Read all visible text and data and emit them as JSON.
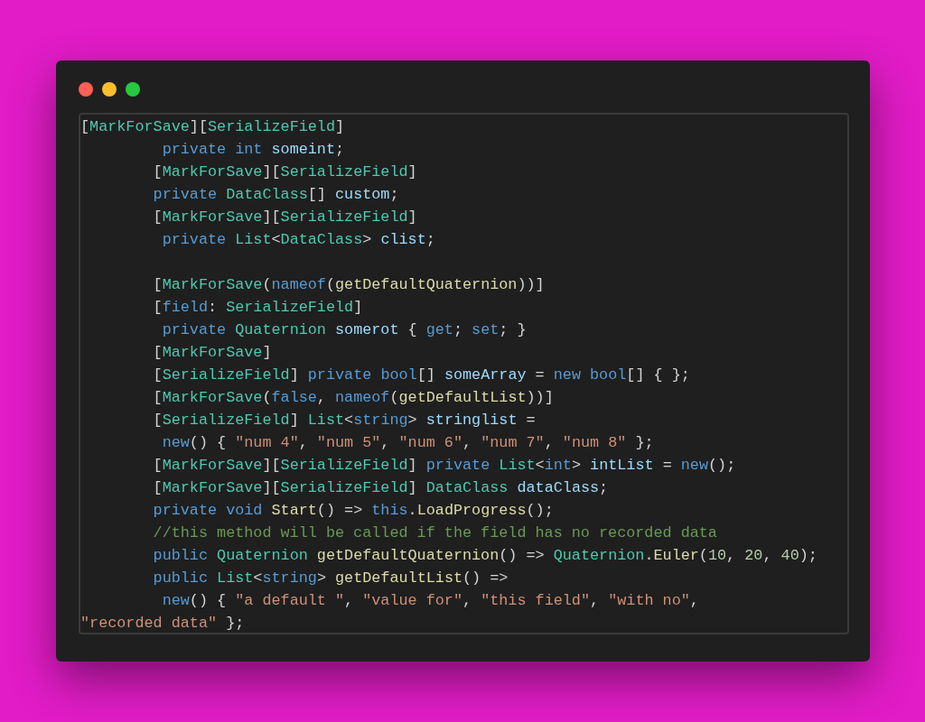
{
  "window": {
    "controls": [
      {
        "kind": "close"
      },
      {
        "kind": "minimize"
      },
      {
        "kind": "zoom"
      }
    ]
  },
  "code": [
    {
      "kind": "flat",
      "tokens": [
        {
          "kind": "plain",
          "text": "["
        },
        {
          "kind": "attr",
          "text": "MarkForSave"
        },
        {
          "kind": "plain",
          "text": "]["
        },
        {
          "kind": "attr",
          "text": "SerializeField"
        },
        {
          "kind": "plain",
          "text": "]"
        }
      ]
    },
    {
      "kind": "deep",
      "tokens": [
        {
          "kind": "keyword",
          "text": "private "
        },
        {
          "kind": "keyword",
          "text": "int "
        },
        {
          "kind": "var",
          "text": "someint"
        },
        {
          "kind": "plain",
          "text": ";"
        }
      ]
    },
    {
      "kind": "indented",
      "tokens": [
        {
          "kind": "plain",
          "text": "["
        },
        {
          "kind": "attr",
          "text": "MarkForSave"
        },
        {
          "kind": "plain",
          "text": "]["
        },
        {
          "kind": "attr",
          "text": "SerializeField"
        },
        {
          "kind": "plain",
          "text": "]"
        }
      ]
    },
    {
      "kind": "indented",
      "tokens": [
        {
          "kind": "keyword",
          "text": "private "
        },
        {
          "kind": "type",
          "text": "DataClass"
        },
        {
          "kind": "plain",
          "text": "[] "
        },
        {
          "kind": "var",
          "text": "custom"
        },
        {
          "kind": "plain",
          "text": ";"
        }
      ]
    },
    {
      "kind": "indented",
      "tokens": [
        {
          "kind": "plain",
          "text": "["
        },
        {
          "kind": "attr",
          "text": "MarkForSave"
        },
        {
          "kind": "plain",
          "text": "]["
        },
        {
          "kind": "attr",
          "text": "SerializeField"
        },
        {
          "kind": "plain",
          "text": "]"
        }
      ]
    },
    {
      "kind": "deep",
      "tokens": [
        {
          "kind": "keyword",
          "text": "private "
        },
        {
          "kind": "type",
          "text": "List"
        },
        {
          "kind": "plain",
          "text": "<"
        },
        {
          "kind": "type",
          "text": "DataClass"
        },
        {
          "kind": "plain",
          "text": "> "
        },
        {
          "kind": "var",
          "text": "clist"
        },
        {
          "kind": "plain",
          "text": ";"
        }
      ]
    },
    {
      "kind": "blank"
    },
    {
      "kind": "indented",
      "tokens": [
        {
          "kind": "plain",
          "text": "["
        },
        {
          "kind": "attr",
          "text": "MarkForSave"
        },
        {
          "kind": "plain",
          "text": "("
        },
        {
          "kind": "keyword",
          "text": "nameof"
        },
        {
          "kind": "plain",
          "text": "("
        },
        {
          "kind": "method",
          "text": "getDefaultQuaternion"
        },
        {
          "kind": "plain",
          "text": "))]"
        }
      ]
    },
    {
      "kind": "indented",
      "tokens": [
        {
          "kind": "plain",
          "text": "["
        },
        {
          "kind": "keyword",
          "text": "field"
        },
        {
          "kind": "plain",
          "text": ": "
        },
        {
          "kind": "attr",
          "text": "SerializeField"
        },
        {
          "kind": "plain",
          "text": "]"
        }
      ]
    },
    {
      "kind": "deep",
      "tokens": [
        {
          "kind": "keyword",
          "text": "private "
        },
        {
          "kind": "type",
          "text": "Quaternion "
        },
        {
          "kind": "var",
          "text": "somerot"
        },
        {
          "kind": "plain",
          "text": " { "
        },
        {
          "kind": "keyword",
          "text": "get"
        },
        {
          "kind": "plain",
          "text": "; "
        },
        {
          "kind": "keyword",
          "text": "set"
        },
        {
          "kind": "plain",
          "text": "; }"
        }
      ]
    },
    {
      "kind": "indented",
      "tokens": [
        {
          "kind": "plain",
          "text": "["
        },
        {
          "kind": "attr",
          "text": "MarkForSave"
        },
        {
          "kind": "plain",
          "text": "]"
        }
      ]
    },
    {
      "kind": "indented",
      "tokens": [
        {
          "kind": "plain",
          "text": "["
        },
        {
          "kind": "attr",
          "text": "SerializeField"
        },
        {
          "kind": "plain",
          "text": "] "
        },
        {
          "kind": "keyword",
          "text": "private "
        },
        {
          "kind": "keyword",
          "text": "bool"
        },
        {
          "kind": "plain",
          "text": "[] "
        },
        {
          "kind": "var",
          "text": "someArray"
        },
        {
          "kind": "plain",
          "text": " = "
        },
        {
          "kind": "keyword",
          "text": "new "
        },
        {
          "kind": "keyword",
          "text": "bool"
        },
        {
          "kind": "plain",
          "text": "[] { };"
        }
      ]
    },
    {
      "kind": "indented",
      "tokens": [
        {
          "kind": "plain",
          "text": "["
        },
        {
          "kind": "attr",
          "text": "MarkForSave"
        },
        {
          "kind": "plain",
          "text": "("
        },
        {
          "kind": "keyword",
          "text": "false"
        },
        {
          "kind": "plain",
          "text": ", "
        },
        {
          "kind": "keyword",
          "text": "nameof"
        },
        {
          "kind": "plain",
          "text": "("
        },
        {
          "kind": "method",
          "text": "getDefaultList"
        },
        {
          "kind": "plain",
          "text": "))]"
        }
      ]
    },
    {
      "kind": "indented",
      "tokens": [
        {
          "kind": "plain",
          "text": "["
        },
        {
          "kind": "attr",
          "text": "SerializeField"
        },
        {
          "kind": "plain",
          "text": "] "
        },
        {
          "kind": "type",
          "text": "List"
        },
        {
          "kind": "plain",
          "text": "<"
        },
        {
          "kind": "keyword",
          "text": "string"
        },
        {
          "kind": "plain",
          "text": "> "
        },
        {
          "kind": "var",
          "text": "stringlist"
        },
        {
          "kind": "plain",
          "text": " ="
        }
      ]
    },
    {
      "kind": "deep",
      "tokens": [
        {
          "kind": "keyword",
          "text": "new"
        },
        {
          "kind": "plain",
          "text": "() { "
        },
        {
          "kind": "string",
          "text": "\"num 4\""
        },
        {
          "kind": "plain",
          "text": ", "
        },
        {
          "kind": "string",
          "text": "\"num 5\""
        },
        {
          "kind": "plain",
          "text": ", "
        },
        {
          "kind": "string",
          "text": "\"num 6\""
        },
        {
          "kind": "plain",
          "text": ", "
        },
        {
          "kind": "string",
          "text": "\"num 7\""
        },
        {
          "kind": "plain",
          "text": ", "
        },
        {
          "kind": "string",
          "text": "\"num 8\""
        },
        {
          "kind": "plain",
          "text": " };"
        }
      ]
    },
    {
      "kind": "indented",
      "tokens": [
        {
          "kind": "plain",
          "text": "["
        },
        {
          "kind": "attr",
          "text": "MarkForSave"
        },
        {
          "kind": "plain",
          "text": "]["
        },
        {
          "kind": "attr",
          "text": "SerializeField"
        },
        {
          "kind": "plain",
          "text": "] "
        },
        {
          "kind": "keyword",
          "text": "private "
        },
        {
          "kind": "type",
          "text": "List"
        },
        {
          "kind": "plain",
          "text": "<"
        },
        {
          "kind": "keyword",
          "text": "int"
        },
        {
          "kind": "plain",
          "text": "> "
        },
        {
          "kind": "var",
          "text": "intList"
        },
        {
          "kind": "plain",
          "text": " = "
        },
        {
          "kind": "keyword",
          "text": "new"
        },
        {
          "kind": "plain",
          "text": "();"
        }
      ]
    },
    {
      "kind": "indented",
      "tokens": [
        {
          "kind": "plain",
          "text": "["
        },
        {
          "kind": "attr",
          "text": "MarkForSave"
        },
        {
          "kind": "plain",
          "text": "]["
        },
        {
          "kind": "attr",
          "text": "SerializeField"
        },
        {
          "kind": "plain",
          "text": "] "
        },
        {
          "kind": "type",
          "text": "DataClass "
        },
        {
          "kind": "var",
          "text": "dataClass"
        },
        {
          "kind": "plain",
          "text": ";"
        }
      ]
    },
    {
      "kind": "indented",
      "tokens": [
        {
          "kind": "keyword",
          "text": "private "
        },
        {
          "kind": "keyword",
          "text": "void "
        },
        {
          "kind": "method",
          "text": "Start"
        },
        {
          "kind": "plain",
          "text": "() => "
        },
        {
          "kind": "keyword",
          "text": "this"
        },
        {
          "kind": "plain",
          "text": "."
        },
        {
          "kind": "method",
          "text": "LoadProgress"
        },
        {
          "kind": "plain",
          "text": "();"
        }
      ]
    },
    {
      "kind": "indented",
      "tokens": [
        {
          "kind": "comment",
          "text": "//this method will be called if the field has no recorded data"
        }
      ]
    },
    {
      "kind": "indented",
      "tokens": [
        {
          "kind": "keyword",
          "text": "public "
        },
        {
          "kind": "type",
          "text": "Quaternion "
        },
        {
          "kind": "method",
          "text": "getDefaultQuaternion"
        },
        {
          "kind": "plain",
          "text": "() => "
        },
        {
          "kind": "type",
          "text": "Quaternion"
        },
        {
          "kind": "plain",
          "text": "."
        },
        {
          "kind": "method",
          "text": "Euler"
        },
        {
          "kind": "plain",
          "text": "("
        },
        {
          "kind": "number",
          "text": "10"
        },
        {
          "kind": "plain",
          "text": ", "
        },
        {
          "kind": "number",
          "text": "20"
        },
        {
          "kind": "plain",
          "text": ", "
        },
        {
          "kind": "number",
          "text": "40"
        },
        {
          "kind": "plain",
          "text": ");"
        }
      ]
    },
    {
      "kind": "indented",
      "tokens": [
        {
          "kind": "keyword",
          "text": "public "
        },
        {
          "kind": "type",
          "text": "List"
        },
        {
          "kind": "plain",
          "text": "<"
        },
        {
          "kind": "keyword",
          "text": "string"
        },
        {
          "kind": "plain",
          "text": "> "
        },
        {
          "kind": "method",
          "text": "getDefaultList"
        },
        {
          "kind": "plain",
          "text": "() =>"
        }
      ]
    },
    {
      "kind": "deep",
      "tokens": [
        {
          "kind": "keyword",
          "text": "new"
        },
        {
          "kind": "plain",
          "text": "() { "
        },
        {
          "kind": "string",
          "text": "\"a default \""
        },
        {
          "kind": "plain",
          "text": ", "
        },
        {
          "kind": "string",
          "text": "\"value for\""
        },
        {
          "kind": "plain",
          "text": ", "
        },
        {
          "kind": "string",
          "text": "\"this field\""
        },
        {
          "kind": "plain",
          "text": ", "
        },
        {
          "kind": "string",
          "text": "\"with no\""
        },
        {
          "kind": "plain",
          "text": ","
        }
      ]
    },
    {
      "kind": "flat",
      "tokens": [
        {
          "kind": "string",
          "text": "\"recorded data\""
        },
        {
          "kind": "plain",
          "text": " };"
        }
      ]
    }
  ]
}
